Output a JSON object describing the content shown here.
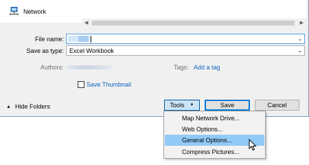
{
  "navigation": {
    "network_label": "Network"
  },
  "form": {
    "file_name_label": "File name:",
    "file_name_value": "",
    "save_as_type_label": "Save as type:",
    "save_as_type_value": "Excel Workbook",
    "authors_label": "Authors:",
    "tags_label": "Tags:",
    "add_tag_link": "Add a tag",
    "save_thumbnail_label": "Save Thumbnail",
    "save_thumbnail_checked": false
  },
  "footer": {
    "hide_folders_label": "Hide Folders",
    "tools_label": "Tools",
    "save_label": "Save",
    "cancel_label": "Cancel"
  },
  "tools_menu": {
    "items": [
      {
        "label": "Map Network Drive..."
      },
      {
        "label": "Web Options..."
      },
      {
        "label": "General Options...",
        "highlighted": true
      },
      {
        "label": "Compress Pictures..."
      }
    ]
  },
  "colors": {
    "link": "#0c64c0",
    "highlight": "#91c9f7",
    "focus_border": "#569de5",
    "dialog_background": "#f0f0f0"
  },
  "icons": {
    "network": "network-icon",
    "hide_folders": "chevron-up-icon",
    "tools_dropdown": "triangle-down-icon",
    "cursor": "mouse-pointer-icon"
  }
}
